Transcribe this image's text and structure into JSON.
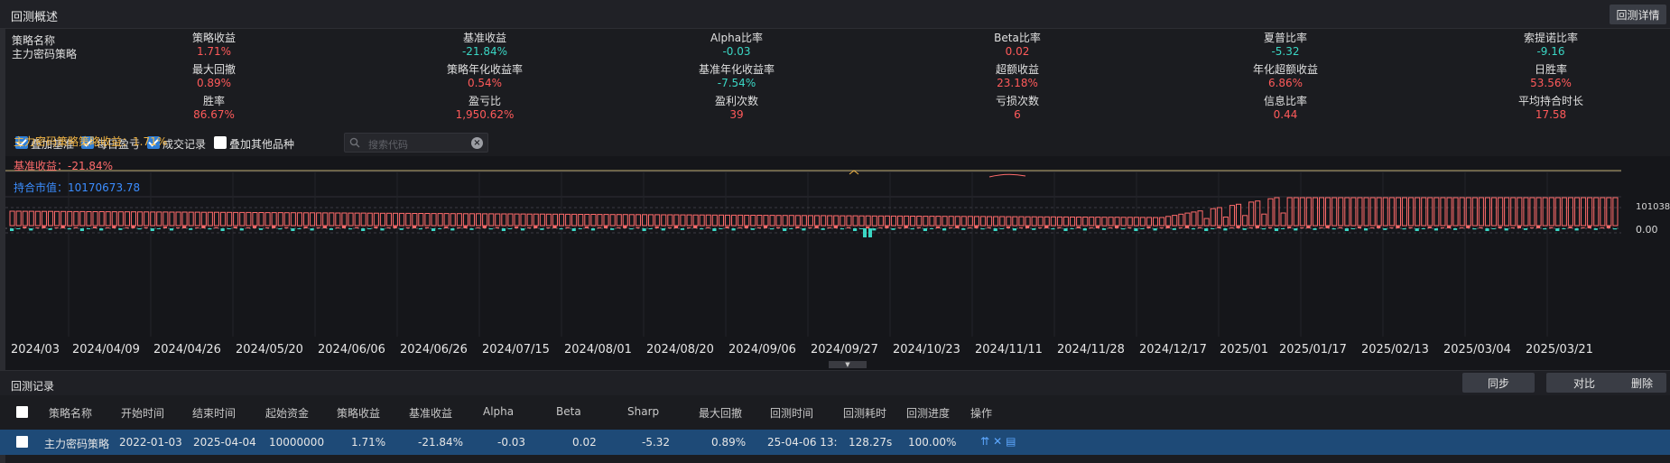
{
  "header": {
    "title": "回测概述",
    "detail_button": "回测详情"
  },
  "strategy": {
    "name_label": "策略名称",
    "name_value": "主力密码策略"
  },
  "metrics": [
    {
      "label": "策略收益",
      "value": "1.71%",
      "color": "red"
    },
    {
      "label": "基准收益",
      "value": "-21.84%",
      "color": "green"
    },
    {
      "label": "Alpha比率",
      "value": "-0.03",
      "color": "green"
    },
    {
      "label": "Beta比率",
      "value": "0.02",
      "color": "red"
    },
    {
      "label": "夏普比率",
      "value": "-5.32",
      "color": "green"
    },
    {
      "label": "索提诺比率",
      "value": "-9.16",
      "color": "green"
    },
    {
      "label": "最大回撤",
      "value": "0.89%",
      "color": "red"
    },
    {
      "label": "策略年化收益率",
      "value": "0.54%",
      "color": "red"
    },
    {
      "label": "基准年化收益率",
      "value": "-7.54%",
      "color": "green"
    },
    {
      "label": "超额收益",
      "value": "23.18%",
      "color": "red"
    },
    {
      "label": "年化超额收益",
      "value": "6.86%",
      "color": "red"
    },
    {
      "label": "日胜率",
      "value": "53.56%",
      "color": "red"
    },
    {
      "label": "胜率",
      "value": "86.67%",
      "color": "red"
    },
    {
      "label": "盈亏比",
      "value": "1,950.62%",
      "color": "red"
    },
    {
      "label": "盈利次数",
      "value": "39",
      "color": "red"
    },
    {
      "label": "亏损次数",
      "value": "6",
      "color": "red"
    },
    {
      "label": "信息比率",
      "value": "0.44",
      "color": "red"
    },
    {
      "label": "平均持合时长",
      "value": "17.58",
      "color": "red"
    }
  ],
  "toolbar": {
    "checkbox_benchmark": "叠加基准",
    "checkbox_daily": "每日盈亏",
    "checkbox_trades": "成交记录",
    "checkbox_other": "叠加其他品种",
    "search_placeholder": "搜索代码"
  },
  "chart": {
    "strategy_label": "主力密码策略策略收益：1.71%",
    "benchmark_label": "基准收益：-21.84%",
    "holding_label": "持合市值：10170673.78",
    "right_tick_top": "10103800",
    "right_tick_zero": "0.00",
    "colors": {
      "strategy": "#f2b544",
      "benchmark": "#ff6b6b",
      "holding": "#3b8dff",
      "positive": "#ff6b6b",
      "negative": "#3ad6c4"
    },
    "x_ticks": [
      "2024/03",
      "2024/04/09",
      "2024/04/26",
      "2024/05/20",
      "2024/06/06",
      "2024/06/26",
      "2024/07/15",
      "2024/08/01",
      "2024/08/20",
      "2024/09/06",
      "2024/09/27",
      "2024/10/23",
      "2024/11/11",
      "2024/11/28",
      "2024/12/17",
      "2025/01",
      "2025/01/17",
      "2025/02/13",
      "2025/03/04",
      "2025/03/21"
    ]
  },
  "records": {
    "title": "回测记录",
    "buttons": {
      "sync": "同步",
      "compare": "对比",
      "delete": "删除"
    },
    "columns": [
      "策略名称",
      "开始时间",
      "结束时间",
      "起始资金",
      "策略收益",
      "基准收益",
      "Alpha",
      "Beta",
      "Sharp",
      "最大回撤",
      "回测时间",
      "回测耗时",
      "回测进度",
      "操作"
    ],
    "rows": [
      {
        "name": "主力密码策略",
        "start": "2022-01-03",
        "end": "2025-04-04",
        "capital": "10000000",
        "strategy_return": "1.71%",
        "benchmark_return": "-21.84%",
        "alpha": "-0.03",
        "beta": "0.02",
        "sharp": "-5.32",
        "max_drawdown": "0.89%",
        "test_time": "25-04-06 13:",
        "duration": "128.27s",
        "progress": "100.00%"
      }
    ]
  }
}
